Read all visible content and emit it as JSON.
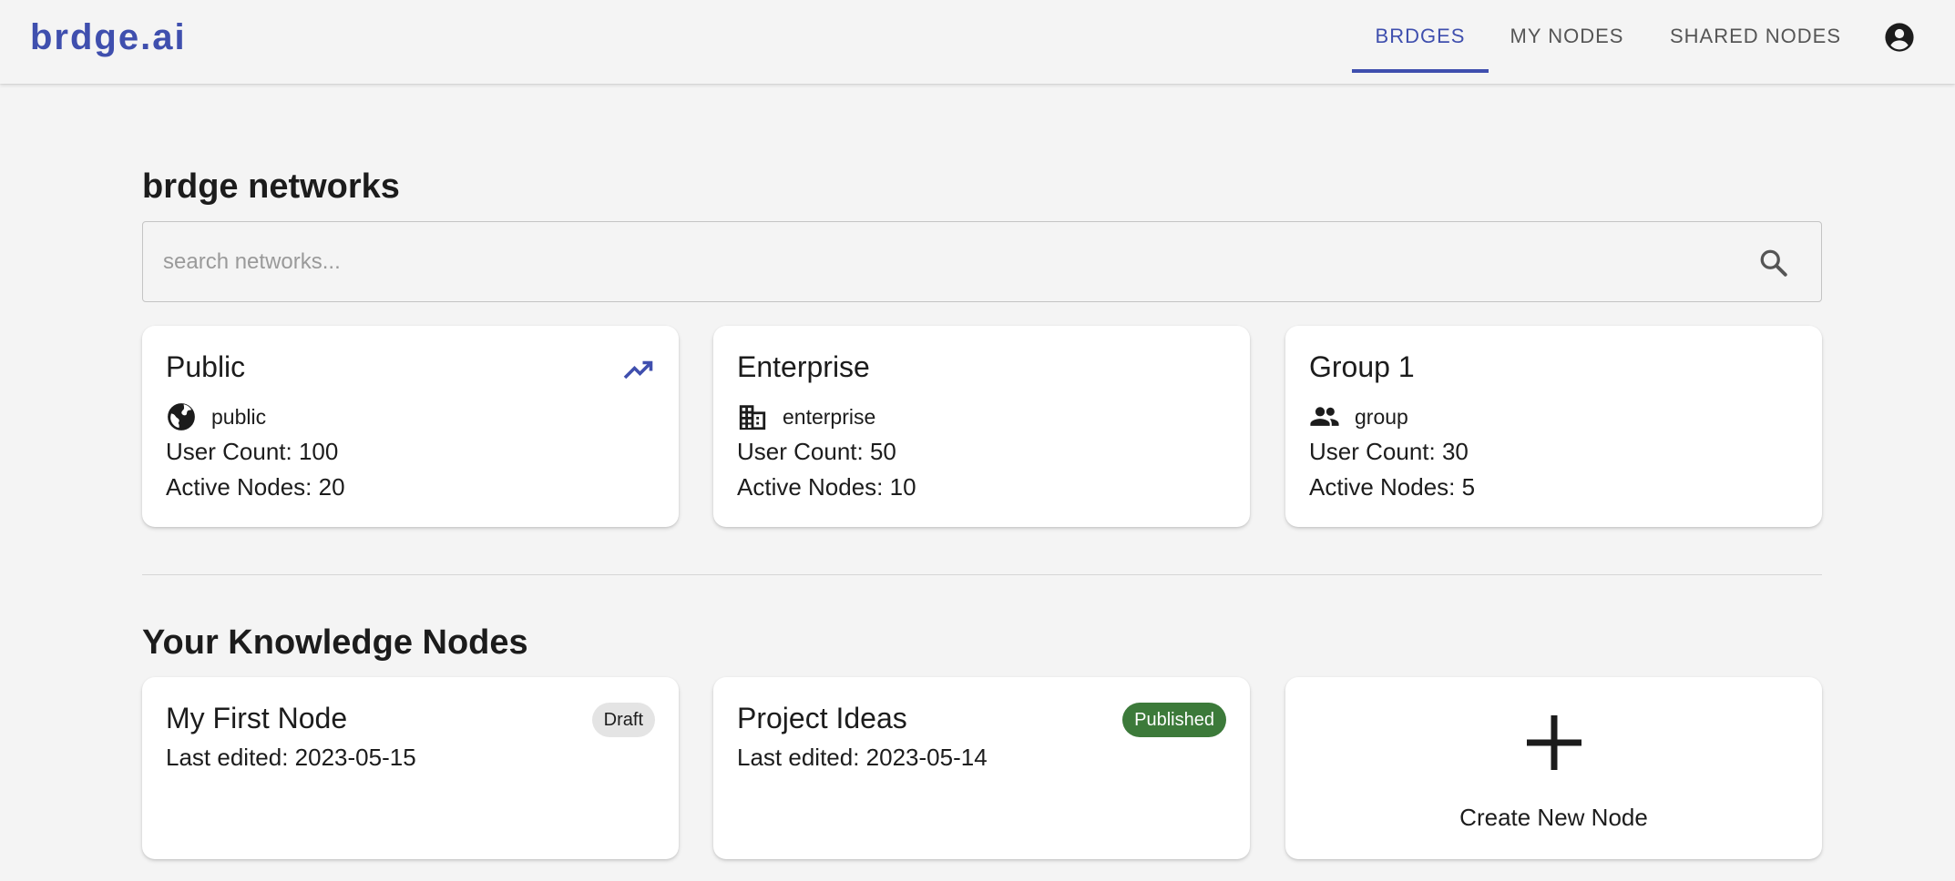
{
  "app": {
    "brand": "brdge.ai",
    "accent_color": "#3f4fae"
  },
  "nav": {
    "tabs": [
      {
        "label": "BRDGES",
        "active": true
      },
      {
        "label": "MY NODES",
        "active": false
      },
      {
        "label": "SHARED NODES",
        "active": false
      }
    ],
    "account_icon": "account-circle-icon"
  },
  "networks": {
    "title": "brdge networks",
    "search": {
      "placeholder": "search networks...",
      "value": "",
      "icon": "search-icon"
    },
    "cards": [
      {
        "name": "Public",
        "type": "public",
        "type_icon": "globe-icon",
        "user_count": "User Count: 100",
        "active_nodes": "Active Nodes: 20",
        "trending": true,
        "trend_icon": "trending-up-icon"
      },
      {
        "name": "Enterprise",
        "type": "enterprise",
        "type_icon": "building-icon",
        "user_count": "User Count: 50",
        "active_nodes": "Active Nodes: 10",
        "trending": false
      },
      {
        "name": "Group 1",
        "type": "group",
        "type_icon": "group-icon",
        "user_count": "User Count: 30",
        "active_nodes": "Active Nodes: 5",
        "trending": false
      }
    ]
  },
  "nodes": {
    "title": "Your Knowledge Nodes",
    "items": [
      {
        "name": "My First Node",
        "last_edited": "Last edited: 2023-05-15",
        "status": "Draft",
        "status_color": "#e4e4e4"
      },
      {
        "name": "Project Ideas",
        "last_edited": "Last edited: 2023-05-14",
        "status": "Published",
        "status_color": "#3c7a3a"
      }
    ],
    "create": {
      "label": "Create New Node",
      "icon": "plus-icon"
    }
  }
}
